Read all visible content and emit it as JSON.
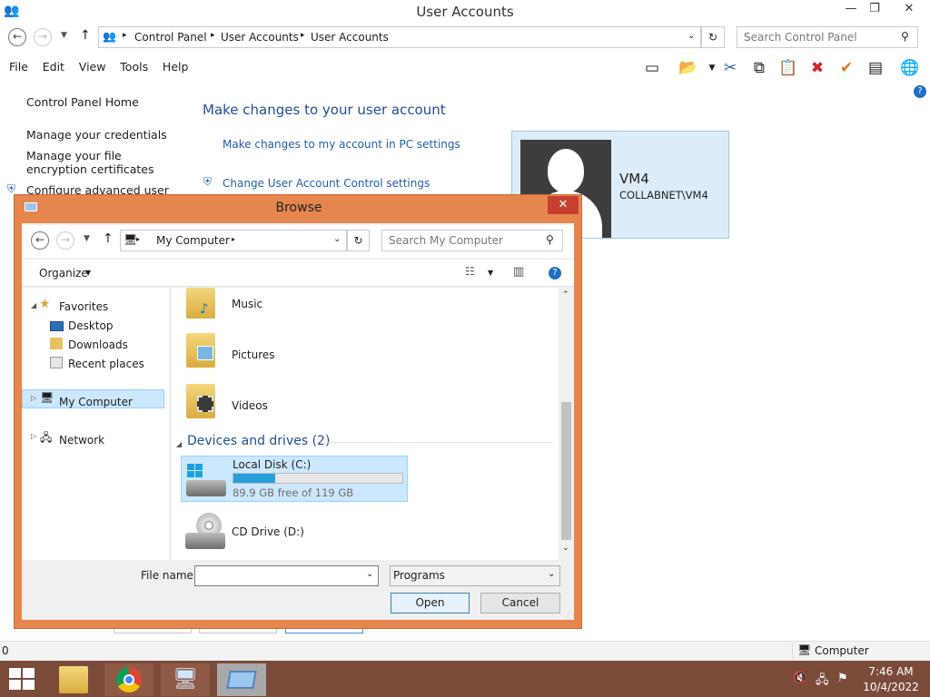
{
  "window": {
    "title": "User Accounts"
  },
  "address": {
    "crumbs": [
      "Control Panel",
      "User Accounts",
      "User Accounts"
    ],
    "search_placeholder": "Search Control Panel"
  },
  "menu": [
    "File",
    "Edit",
    "View",
    "Tools",
    "Help"
  ],
  "leftnav": {
    "home": "Control Panel Home",
    "credentials": "Manage your credentials",
    "encryption": "Manage your file encryption certificates",
    "advanced": "Configure advanced user"
  },
  "main": {
    "heading": "Make changes to your user account",
    "pc_settings": "Make changes to my account in PC settings",
    "uac": "Change User Account Control settings"
  },
  "user": {
    "name": "VM4",
    "account": "COLLABNET\\VM4"
  },
  "status": {
    "left": "0",
    "right": "Computer"
  },
  "clock": {
    "time": "7:46 AM",
    "date": "10/4/2022"
  },
  "dialog": {
    "title": "Browse",
    "location": "My Computer",
    "search_placeholder": "Search My Computer",
    "organize": "Organize",
    "tree": {
      "favorites": "Favorites",
      "desktop": "Desktop",
      "downloads": "Downloads",
      "recent": "Recent places",
      "computer": "My Computer",
      "network": "Network"
    },
    "folders": [
      "Music",
      "Pictures",
      "Videos"
    ],
    "devices_header": "Devices and drives (2)",
    "local_disk": {
      "name": "Local Disk (C:)",
      "free": "89.9 GB free of 119 GB",
      "used_fraction": 0.245
    },
    "cd_drive": "CD Drive (D:)",
    "filename_label": "File name:",
    "filename_value": "",
    "filetype": "Programs",
    "open": "Open",
    "cancel": "Cancel"
  }
}
